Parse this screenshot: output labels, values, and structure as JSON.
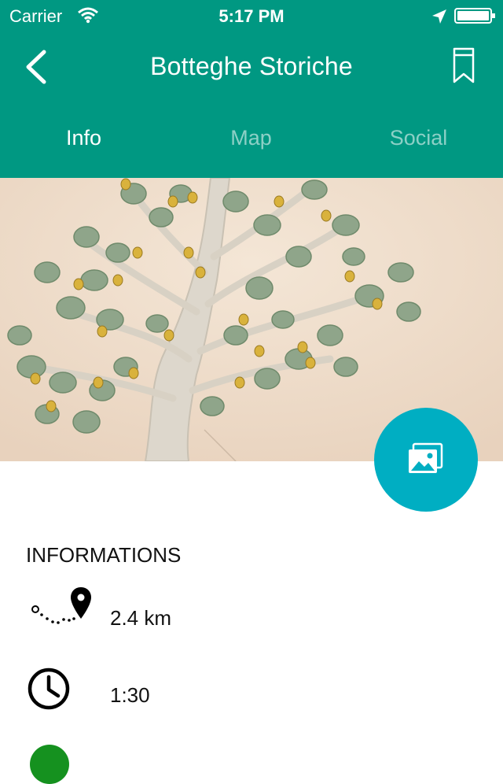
{
  "status_bar": {
    "carrier": "Carrier",
    "time": "5:17 PM",
    "wifi_icon": "wifi-icon",
    "location_icon": "location-arrow-icon",
    "battery_icon": "battery-full-icon"
  },
  "header": {
    "title": "Botteghe Storiche",
    "back_icon": "chevron-left-icon",
    "bookmark_icon": "bookmark-icon",
    "background_color": "#009882"
  },
  "tabs": [
    {
      "label": "Info",
      "active": true
    },
    {
      "label": "Map",
      "active": false
    },
    {
      "label": "Social",
      "active": false
    }
  ],
  "hero": {
    "image": "decorative-tree-relief-image"
  },
  "gallery_button": {
    "icon": "image-gallery-icon",
    "color": "#00aec2"
  },
  "info": {
    "heading": "INFORMATIONS",
    "distance": {
      "icon": "route-distance-icon",
      "value": "2.4 km"
    },
    "duration": {
      "icon": "clock-icon",
      "value": "1:30"
    },
    "difficulty": {
      "icon": "difficulty-dot-icon",
      "color": "#15911f"
    }
  }
}
